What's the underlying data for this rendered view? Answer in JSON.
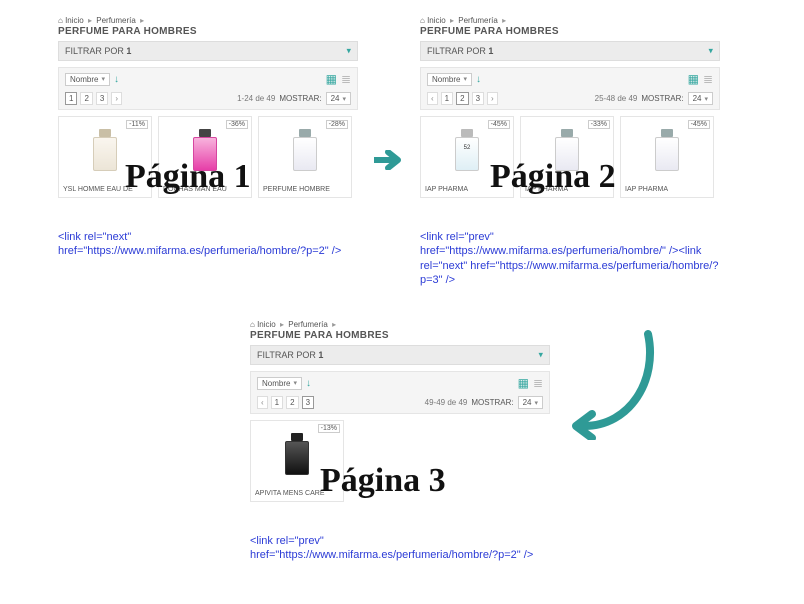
{
  "breadcrumb": {
    "home": "Inicio",
    "cat": "Perfumería"
  },
  "heading": "PERFUME PARA HOMBRES",
  "filter_label": "FILTRAR POR",
  "filter_count": "1",
  "sort_label": "Nombre",
  "show_label": "MOSTRAR:",
  "per_page": "24",
  "pages": {
    "p1": {
      "overlay": "Página 1",
      "count": "1-24 de 49",
      "pager": {
        "items": [
          "1",
          "2",
          "3"
        ],
        "active": "1",
        "prev": false,
        "next": true
      },
      "products": [
        {
          "discount": "-11%",
          "name": "YSL HOMME EAU DE",
          "style": "cream"
        },
        {
          "discount": "-36%",
          "name": "ROCHAS MAN EAU",
          "style": "pink"
        },
        {
          "discount": "-28%",
          "name": "PERFUME HOMBRE",
          "style": "clear"
        }
      ],
      "code": "<link rel=\"next\" href=\"https://www.mifarma.es/perfumeria/hombre/?p=2\" />"
    },
    "p2": {
      "overlay": "Página 2",
      "count": "25-48 de 49",
      "pager": {
        "items": [
          "1",
          "2",
          "3"
        ],
        "active": "2",
        "prev": true,
        "next": true
      },
      "products": [
        {
          "discount": "-45%",
          "name": "IAP PHARMA",
          "style": "lightblue",
          "label": "52"
        },
        {
          "discount": "-33%",
          "name": "IAP PHARMA",
          "style": "clear"
        },
        {
          "discount": "-45%",
          "name": "IAP PHARMA",
          "style": "clear"
        }
      ],
      "code": "<link rel=\"prev\" href=\"https://www.mifarma.es/perfumeria/hombre/\" /><link rel=\"next\" href=\"https://www.mifarma.es/perfumeria/hombre/?p=3\" />"
    },
    "p3": {
      "overlay": "Página 3",
      "count": "49-49 de 49",
      "pager": {
        "items": [
          "1",
          "2",
          "3"
        ],
        "active": "3",
        "prev": true,
        "next": false
      },
      "products": [
        {
          "discount": "-13%",
          "name": "APIVITA MENS CARE",
          "style": "dark"
        }
      ],
      "code": "<link rel=\"prev\" href=\"https://www.mifarma.es/perfumeria/hombre/?p=2\" />"
    }
  }
}
